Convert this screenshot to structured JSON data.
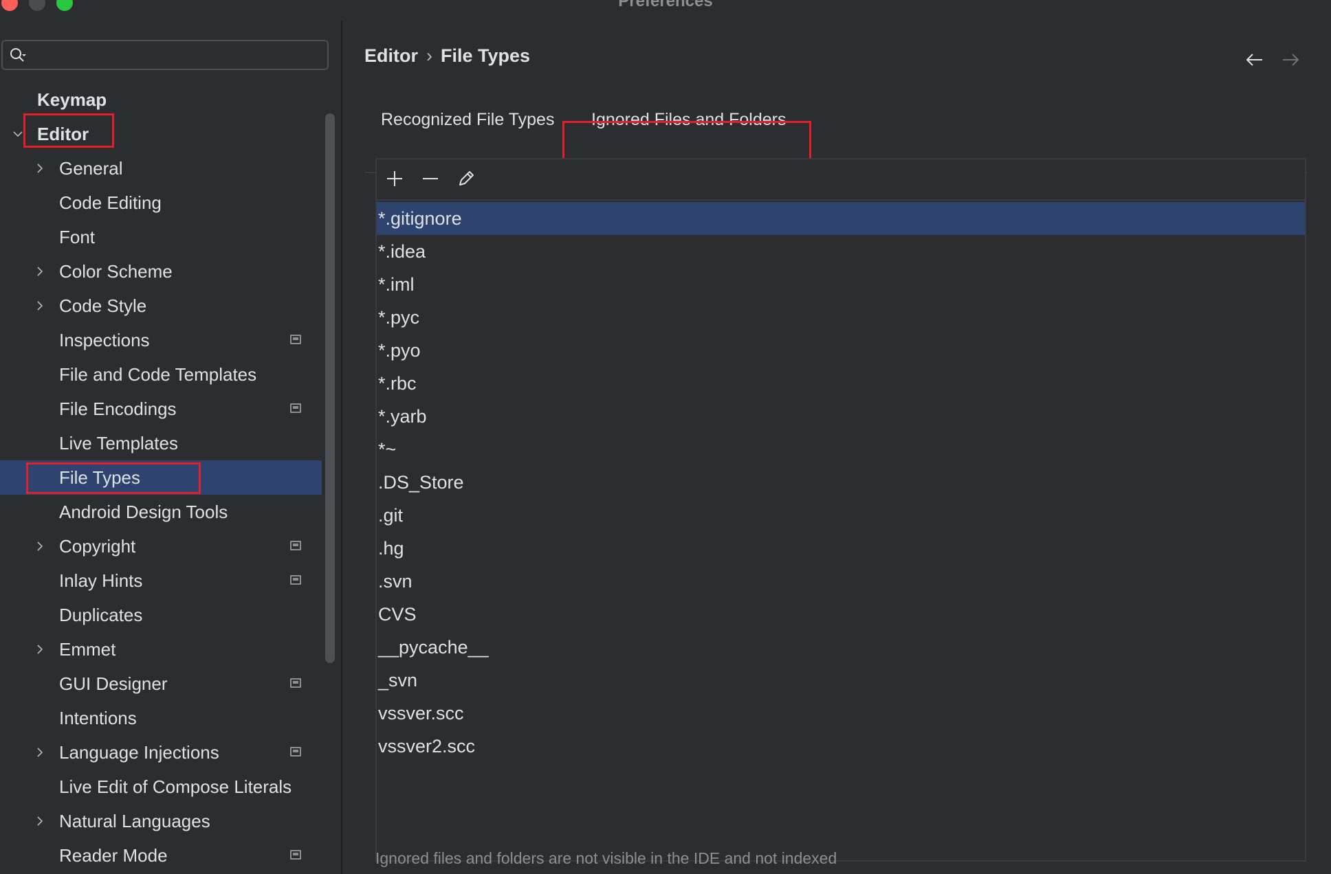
{
  "window": {
    "title": "Preferences"
  },
  "search": {
    "placeholder": ""
  },
  "sidebar": {
    "items": [
      {
        "label": "Keymap"
      },
      {
        "label": "Editor"
      },
      {
        "label": "General"
      },
      {
        "label": "Code Editing"
      },
      {
        "label": "Font"
      },
      {
        "label": "Color Scheme"
      },
      {
        "label": "Code Style"
      },
      {
        "label": "Inspections"
      },
      {
        "label": "File and Code Templates"
      },
      {
        "label": "File Encodings"
      },
      {
        "label": "Live Templates"
      },
      {
        "label": "File Types"
      },
      {
        "label": "Android Design Tools"
      },
      {
        "label": "Copyright"
      },
      {
        "label": "Inlay Hints"
      },
      {
        "label": "Duplicates"
      },
      {
        "label": "Emmet"
      },
      {
        "label": "GUI Designer"
      },
      {
        "label": "Intentions"
      },
      {
        "label": "Language Injections"
      },
      {
        "label": "Live Edit of Compose Literals"
      },
      {
        "label": "Natural Languages"
      },
      {
        "label": "Reader Mode"
      }
    ]
  },
  "breadcrumb": {
    "parent": "Editor",
    "separator": "›",
    "current": "File Types"
  },
  "tabs": [
    {
      "label": "Recognized File Types"
    },
    {
      "label": "Ignored Files and Folders"
    }
  ],
  "ignored": {
    "items": [
      "*.gitignore",
      "*.idea",
      "*.iml",
      "*.pyc",
      "*.pyo",
      "*.rbc",
      "*.yarb",
      "*~",
      ".DS_Store",
      ".git",
      ".hg",
      ".svn",
      "CVS",
      "__pycache__",
      "_svn",
      "vssver.scc",
      "vssver2.scc"
    ],
    "footnote": "Ignored files and folders are not visible in the IDE and not indexed"
  },
  "colors": {
    "accent": "#3574f0",
    "selection": "#2e436e",
    "highlight_box": "#e0202a",
    "background": "#2b2d30"
  }
}
